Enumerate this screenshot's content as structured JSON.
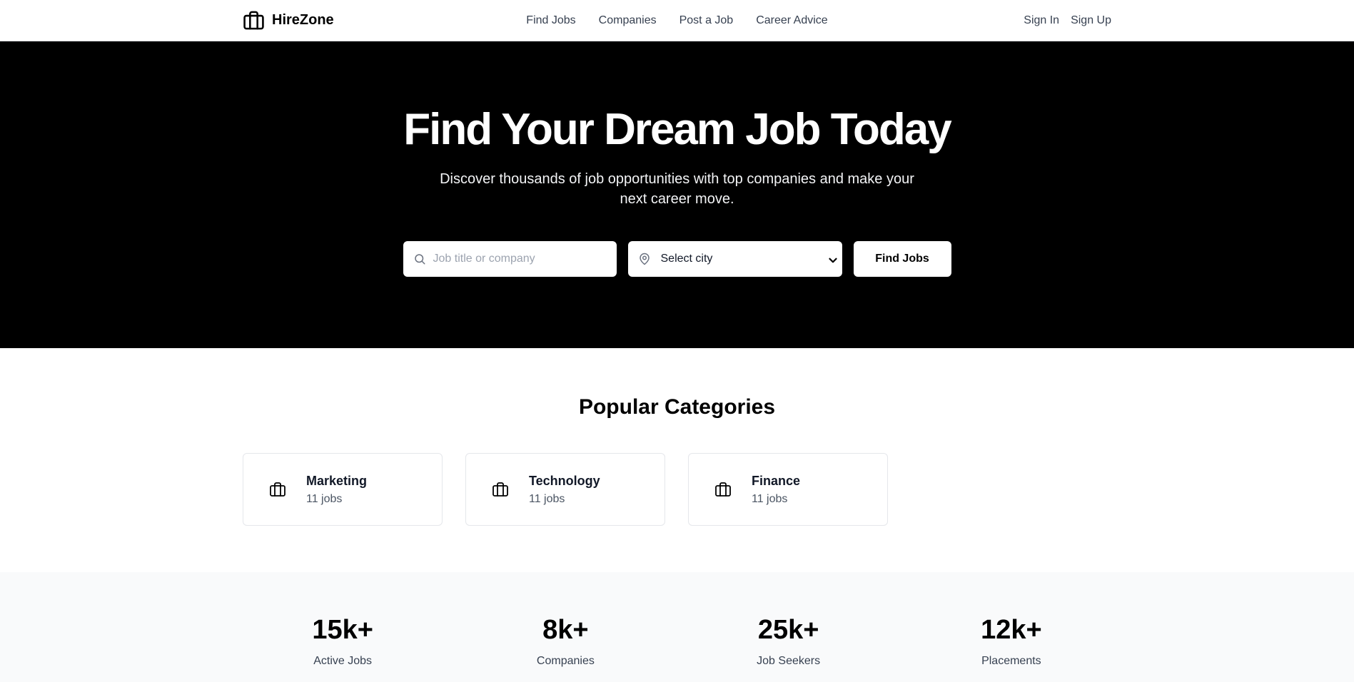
{
  "header": {
    "brand": "HireZone",
    "nav": [
      "Find Jobs",
      "Companies",
      "Post a Job",
      "Career Advice"
    ],
    "sign_in": "Sign In",
    "sign_up": "Sign Up"
  },
  "hero": {
    "title": "Find Your Dream Job Today",
    "subtitle": "Discover thousands of job opportunities with top companies and make your next career move.",
    "search_placeholder": "Job title or company",
    "city_selected": "Select city",
    "find_button": "Find Jobs"
  },
  "categories": {
    "title": "Popular Categories",
    "items": [
      {
        "name": "Marketing",
        "count": "11 jobs"
      },
      {
        "name": "Technology",
        "count": "11 jobs"
      },
      {
        "name": "Finance",
        "count": "11 jobs"
      }
    ]
  },
  "stats": [
    {
      "value": "15k+",
      "label": "Active Jobs"
    },
    {
      "value": "8k+",
      "label": "Companies"
    },
    {
      "value": "25k+",
      "label": "Job Seekers"
    },
    {
      "value": "12k+",
      "label": "Placements"
    }
  ],
  "icons": {
    "logo": "briefcase-icon",
    "search": "search-icon",
    "location": "map-pin-icon",
    "category": "briefcase-icon",
    "dropdown": "chevron-down-icon"
  },
  "colors": {
    "hero_bg": "#000000",
    "stats_bg": "#f9fafb",
    "card_border": "#e5e7eb"
  }
}
